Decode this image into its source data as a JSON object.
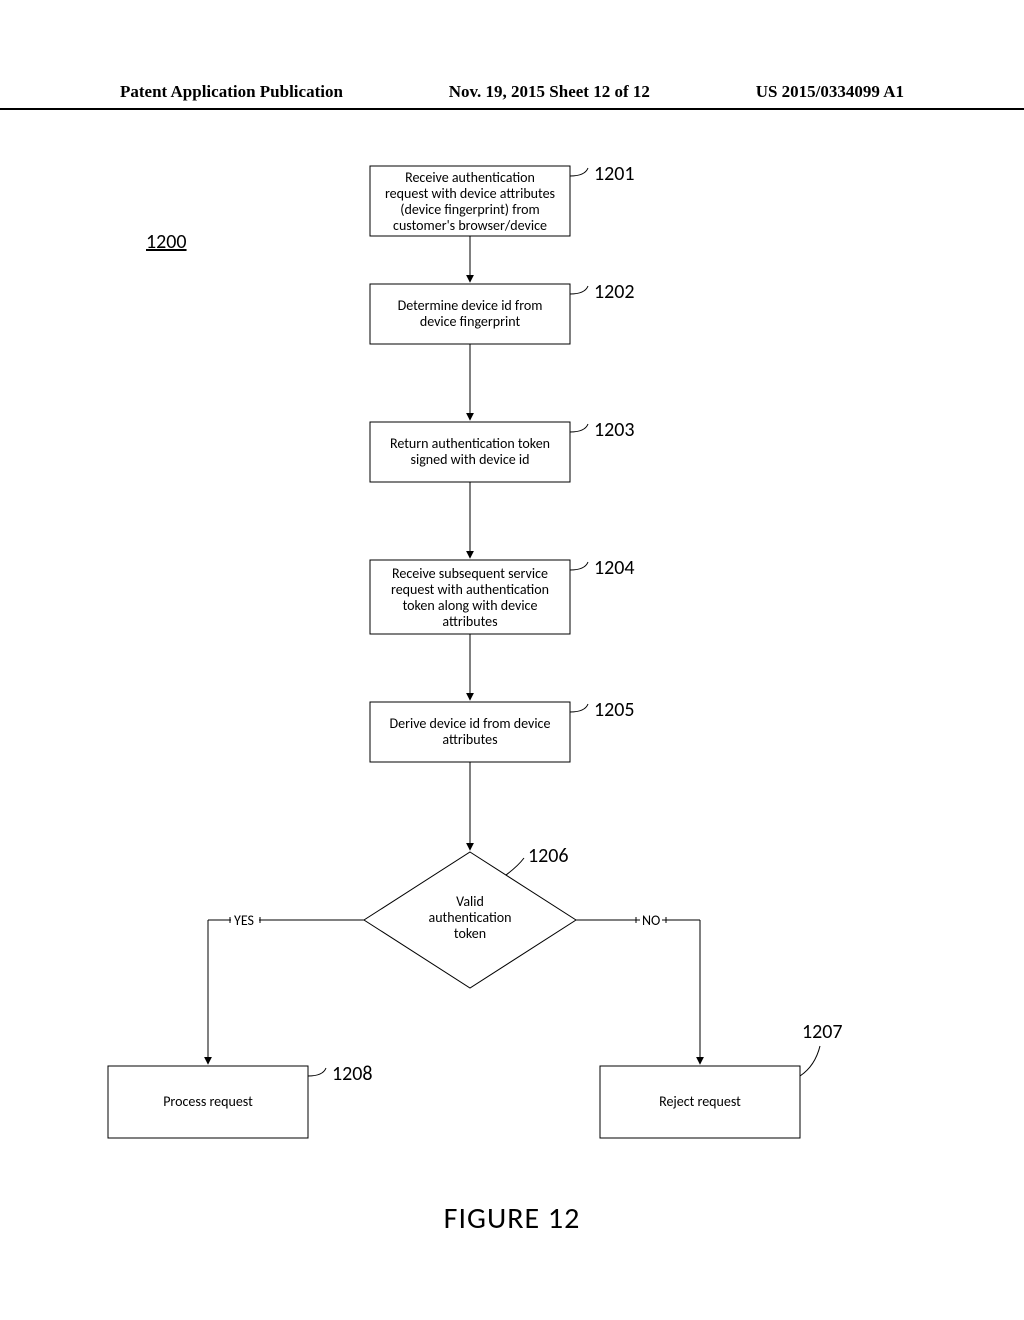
{
  "header": {
    "left": "Patent Application Publication",
    "mid": "Nov. 19, 2015   Sheet 12 of 12",
    "right": "US 2015/0334099 A1"
  },
  "figure_ref": "1200",
  "boxes": {
    "b1201": {
      "ref": "1201",
      "lines": [
        "Receive authentication",
        "request with device attributes",
        "(device fingerprint) from",
        "customer's browser/device"
      ]
    },
    "b1202": {
      "ref": "1202",
      "lines": [
        "Determine device id from",
        "device fingerprint"
      ]
    },
    "b1203": {
      "ref": "1203",
      "lines": [
        "Return authentication token",
        "signed with device id"
      ]
    },
    "b1204": {
      "ref": "1204",
      "lines": [
        "Receive subsequent service",
        "request with authentication",
        "token along with device",
        "attributes"
      ]
    },
    "b1205": {
      "ref": "1205",
      "lines": [
        "Derive device id from device",
        "attributes"
      ]
    },
    "b1206": {
      "ref": "1206",
      "lines": [
        "Valid",
        "authentication",
        "token"
      ]
    },
    "b1207": {
      "ref": "1207",
      "lines": [
        "Reject request"
      ]
    },
    "b1208": {
      "ref": "1208",
      "lines": [
        "Process request"
      ]
    }
  },
  "branches": {
    "yes": "YES",
    "no": "NO"
  },
  "title": "FIGURE 12"
}
